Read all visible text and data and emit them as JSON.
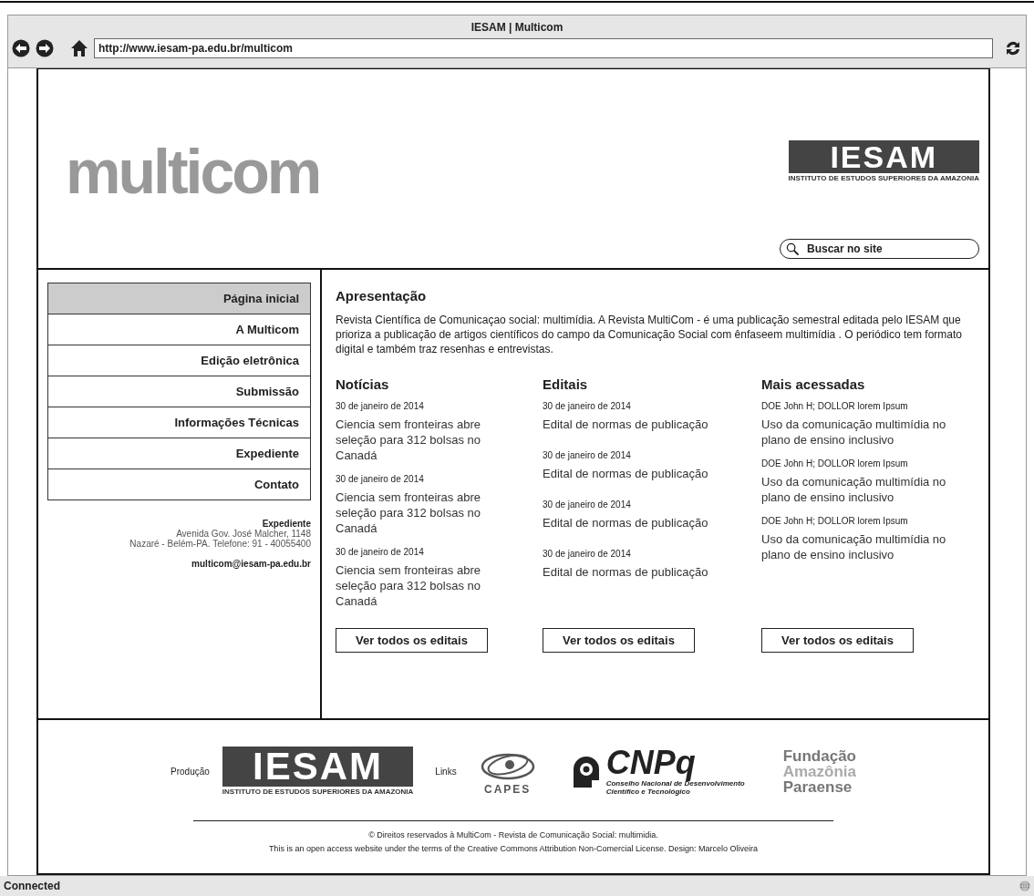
{
  "window": {
    "title": "IESAM | Multicom",
    "url": "http://www.iesam-pa.edu.br/multicom"
  },
  "header": {
    "logo": "multicom",
    "partner_logo": {
      "name": "IESAM",
      "subtitle": "INSTITUTO DE ESTUDOS SUPERIORES DA AMAZONIA"
    },
    "search": {
      "placeholder": "Buscar no site"
    }
  },
  "sidebar": {
    "items": [
      {
        "label": "Página inicial",
        "selected": true
      },
      {
        "label": "A Multicom",
        "selected": false
      },
      {
        "label": "Edição eletrônica",
        "selected": false
      },
      {
        "label": "Submissão",
        "selected": false
      },
      {
        "label": "Informações Técnicas",
        "selected": false
      },
      {
        "label": "Expediente",
        "selected": false
      },
      {
        "label": "Contato",
        "selected": false
      }
    ],
    "contact": {
      "heading": "Expediente",
      "lines": [
        "Avenida Gov. José Malcher, 1148",
        "Nazaré - Belém-PA. Telefone: 91 - 40055400"
      ],
      "email": "multicom@iesam-pa.edu.br"
    }
  },
  "intro": {
    "heading": "Apresentação",
    "text": "Revista Científica de Comunicaçao social: multimídia. A Revista MultiCom -  é uma publicação semestral editada pelo IESAM que prioriza a publicação de artigos científicos do campo da Comunicação Social com ênfaseem multimídia . O periódico tem formato digital e também traz resenhas e entrevistas."
  },
  "columns": [
    {
      "heading": "Notícias",
      "items": [
        {
          "meta": "30 de janeiro de 2014",
          "title": "Ciencia sem fronteiras abre seleção para 312 bolsas no Canadá"
        },
        {
          "meta": "30 de janeiro de 2014",
          "title": "Ciencia sem fronteiras abre seleção para 312 bolsas no Canadá"
        },
        {
          "meta": "30 de janeiro de 2014",
          "title": "Ciencia sem fronteiras abre seleção para 312 bolsas no Canadá"
        }
      ],
      "button": "Ver todos os editais"
    },
    {
      "heading": "Editais",
      "items": [
        {
          "meta": "30 de janeiro de 2014",
          "title": "Edital de normas de publicação"
        },
        {
          "meta": "30 de janeiro de 2014",
          "title": "Edital de normas de publicação"
        },
        {
          "meta": "30 de janeiro de 2014",
          "title": "Edital de normas de publicação"
        },
        {
          "meta": "30 de janeiro de 2014",
          "title": "Edital de normas de publicação"
        }
      ],
      "button": "Ver todos os editais"
    },
    {
      "heading": "Mais acessadas",
      "items": [
        {
          "meta": "DOE John H;  DOLLOR lorem Ipsum",
          "title": "Uso da comunicação multimídia no plano de ensino inclusivo"
        },
        {
          "meta": "DOE John H;  DOLLOR lorem Ipsum",
          "title": "Uso da comunicação multimídia no plano de ensino inclusivo"
        },
        {
          "meta": "DOE John H;  DOLLOR lorem Ipsum",
          "title": "Uso da comunicação multimídia no plano de ensino inclusivo"
        }
      ],
      "button": "Ver todos os editais"
    }
  ],
  "footer": {
    "production_label": "Produção",
    "production_logo": {
      "name": "IESAM",
      "subtitle": "INSTITUTO DE ESTUDOS SUPERIORES DA AMAZONIA"
    },
    "links_label": "Links",
    "capes": "CAPES",
    "cnpq": {
      "name": "CNPq",
      "subtitle": "Conselho Nacional de Desenvolvimento Científico e Tecnológico"
    },
    "fapespa": [
      "Fundação",
      "Amazônia",
      "Paraense"
    ],
    "lines": [
      "© Direitos reservados à MultiCom - Revista de Comunicação Social: multimidia.",
      "This is an open access website under the terms of the Creative Commons Attribution Non-Comercial License. Design: Marcelo Oliveira"
    ]
  },
  "status_bar": {
    "text": "Connected"
  }
}
